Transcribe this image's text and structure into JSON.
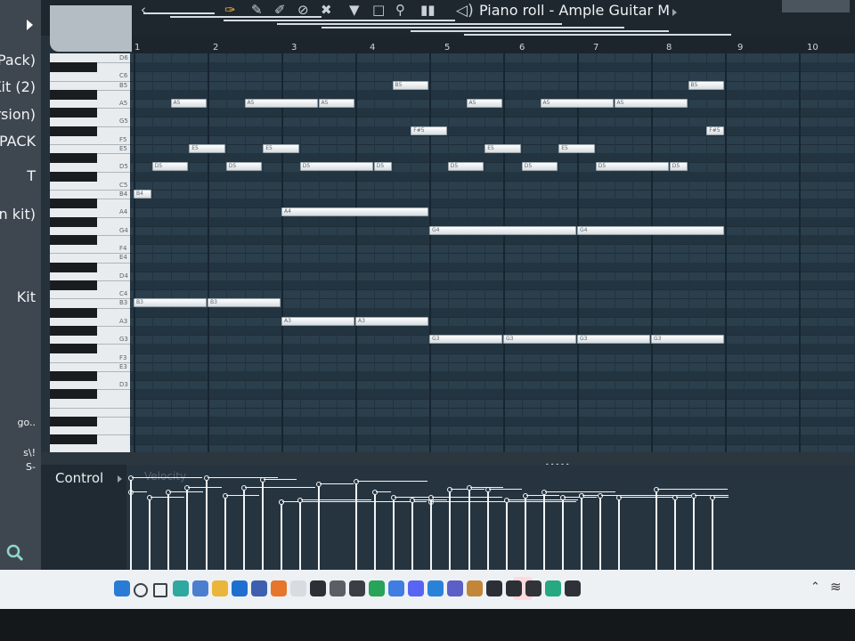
{
  "sidebar": {
    "items": [
      "Pack)",
      "Kit (2)",
      "rsion)",
      "PACK",
      "T",
      "n kit)",
      "Kit",
      "go..",
      "s\\!",
      "S-"
    ]
  },
  "toolbar": {
    "title": "Piano roll - Ample Guitar M",
    "icons": [
      "back-arrow-icon",
      "magnet-icon",
      "pencil-icon",
      "brush-icon",
      "delete-icon",
      "mute-icon",
      "slice-icon",
      "select-icon",
      "zoom-icon",
      "playback-icon",
      "speaker-icon"
    ]
  },
  "ruler": {
    "bars": [
      "1",
      "2",
      "3",
      "4",
      "5",
      "6",
      "7",
      "8",
      "9",
      "10"
    ]
  },
  "keyboard": {
    "labels": [
      "D6",
      "C6",
      "B5",
      "A5",
      "G5",
      "F5",
      "E5",
      "D5",
      "C5",
      "B4",
      "A4",
      "G4",
      "F4",
      "E4",
      "D4",
      "C4",
      "B3",
      "A3",
      "G3",
      "F3",
      "E3",
      "D3"
    ]
  },
  "notes": [
    {
      "pitch": "B4",
      "label": "B4",
      "start": 1.0,
      "len": 0.25
    },
    {
      "pitch": "A5",
      "label": "A5",
      "start": 1.5,
      "len": 0.5
    },
    {
      "pitch": "E5",
      "label": "E5",
      "start": 1.75,
      "len": 0.5
    },
    {
      "pitch": "D5",
      "label": "D5",
      "start": 1.25,
      "len": 0.5
    },
    {
      "pitch": "B3",
      "label": "B3",
      "start": 1.0,
      "len": 1.0
    },
    {
      "pitch": "B3",
      "label": "B3",
      "start": 2.0,
      "len": 1.0
    },
    {
      "pitch": "A5",
      "label": "A5",
      "start": 2.5,
      "len": 1.0
    },
    {
      "pitch": "E5",
      "label": "E5",
      "start": 2.75,
      "len": 0.5
    },
    {
      "pitch": "D5",
      "label": "D5",
      "start": 2.25,
      "len": 0.5
    },
    {
      "pitch": "A5",
      "label": "A5",
      "start": 3.5,
      "len": 0.5
    },
    {
      "pitch": "A4",
      "label": "A4",
      "start": 3.0,
      "len": 2.0
    },
    {
      "pitch": "D5",
      "label": "D5",
      "start": 3.25,
      "len": 1.0
    },
    {
      "pitch": "D5",
      "label": "D5",
      "start": 4.25,
      "len": 0.25
    },
    {
      "pitch": "A3",
      "label": "A3",
      "start": 3.0,
      "len": 1.0
    },
    {
      "pitch": "A3",
      "label": "A3",
      "start": 4.0,
      "len": 1.0
    },
    {
      "pitch": "B5",
      "label": "B5",
      "start": 4.5,
      "len": 0.5
    },
    {
      "pitch": "F#5",
      "label": "F#5",
      "start": 4.75,
      "len": 0.5
    },
    {
      "pitch": "G4",
      "label": "G4",
      "start": 5.0,
      "len": 2.0
    },
    {
      "pitch": "G4",
      "label": "G4",
      "start": 7.0,
      "len": 2.0
    },
    {
      "pitch": "D5",
      "label": "D5",
      "start": 5.25,
      "len": 0.5
    },
    {
      "pitch": "A5",
      "label": "A5",
      "start": 5.5,
      "len": 0.5
    },
    {
      "pitch": "E5",
      "label": "E5",
      "start": 5.75,
      "len": 0.5
    },
    {
      "pitch": "D5",
      "label": "D5",
      "start": 6.25,
      "len": 0.5
    },
    {
      "pitch": "A5",
      "label": "A5",
      "start": 6.5,
      "len": 1.0
    },
    {
      "pitch": "A5",
      "label": "A5",
      "start": 7.5,
      "len": 1.0
    },
    {
      "pitch": "E5",
      "label": "E5",
      "start": 6.75,
      "len": 0.5
    },
    {
      "pitch": "D5",
      "label": "D5",
      "start": 7.25,
      "len": 1.0
    },
    {
      "pitch": "D5",
      "label": "D5",
      "start": 8.25,
      "len": 0.25
    },
    {
      "pitch": "G3",
      "label": "G3",
      "start": 5.0,
      "len": 1.0
    },
    {
      "pitch": "G3",
      "label": "G3",
      "start": 6.0,
      "len": 1.0
    },
    {
      "pitch": "G3",
      "label": "G3",
      "start": 7.0,
      "len": 1.0
    },
    {
      "pitch": "G3",
      "label": "G3",
      "start": 8.0,
      "len": 1.0
    },
    {
      "pitch": "B5",
      "label": "B5",
      "start": 8.5,
      "len": 0.5
    },
    {
      "pitch": "F#5",
      "label": "F#5",
      "start": 8.75,
      "len": 0.25
    }
  ],
  "control": {
    "label": "Control",
    "target": "Velocity",
    "velocities": [
      0.78,
      0.92,
      0.72,
      0.78,
      0.82,
      0.92,
      0.74,
      0.82,
      0.9,
      0.68,
      0.68,
      0.7,
      0.86,
      0.88,
      0.78,
      0.72,
      0.7,
      0.68,
      0.72,
      0.8,
      0.82,
      0.8,
      0.7,
      0.74,
      0.78,
      0.72,
      0.74,
      0.74,
      0.74,
      0.72,
      0.8,
      0.72,
      0.74,
      0.72,
      0.72,
      0.72
    ]
  },
  "taskbar": {
    "apps": [
      {
        "name": "windows-start-icon",
        "color": "#2a7bd6"
      },
      {
        "name": "search-icon",
        "color": "#3b4148"
      },
      {
        "name": "task-view-icon",
        "color": "#3b4148"
      },
      {
        "name": "edge-icon",
        "color": "#2fa8a0"
      },
      {
        "name": "store-icon",
        "color": "#4a7fd0"
      },
      {
        "name": "file-explorer-icon",
        "color": "#e9b53a"
      },
      {
        "name": "outlook-icon",
        "color": "#1f6fcf"
      },
      {
        "name": "b-app-icon",
        "color": "#3e5fb0"
      },
      {
        "name": "firefox-icon",
        "color": "#e5762b"
      },
      {
        "name": "media-player-icon",
        "color": "#d8dbe0"
      },
      {
        "name": "steam-icon",
        "color": "#2b3037"
      },
      {
        "name": "chatgpt-icon",
        "color": "#5a5f66"
      },
      {
        "name": "capcut-icon",
        "color": "#3a3f46"
      },
      {
        "name": "google-drive-icon",
        "color": "#27a35a"
      },
      {
        "name": "upload-icon",
        "color": "#3f7de0"
      },
      {
        "name": "discord-icon",
        "color": "#5865f2"
      },
      {
        "name": "notepad-icon",
        "color": "#2a82d8"
      },
      {
        "name": "teams-icon",
        "color": "#5b5fc7"
      },
      {
        "name": "fl-studio-icon",
        "color": "#c2863a"
      },
      {
        "name": "epic-games-icon",
        "color": "#2c3036"
      },
      {
        "name": "terminal-icon",
        "color": "#2c3036"
      },
      {
        "name": "obs-icon",
        "color": "#303338"
      },
      {
        "name": "app-green-icon",
        "color": "#26a880"
      },
      {
        "name": "notion-icon",
        "color": "#2e3238"
      }
    ],
    "tray": [
      "chevron-up-icon",
      "wifi-icon"
    ]
  }
}
